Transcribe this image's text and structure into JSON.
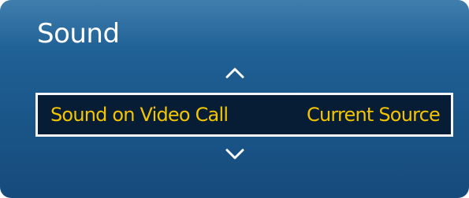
{
  "menu": {
    "title": "Sound",
    "scroll_up_icon": "chevron-up-icon",
    "scroll_down_icon": "chevron-down-icon",
    "selected_item": {
      "label": "Sound on Video Call",
      "value": "Current Source"
    }
  },
  "colors": {
    "panel_blue": "#1d5a8d",
    "highlight_bg": "#061d35",
    "highlight_border": "#f7f7f7",
    "highlight_text": "#f5c400",
    "title_text": "#ffffff"
  }
}
